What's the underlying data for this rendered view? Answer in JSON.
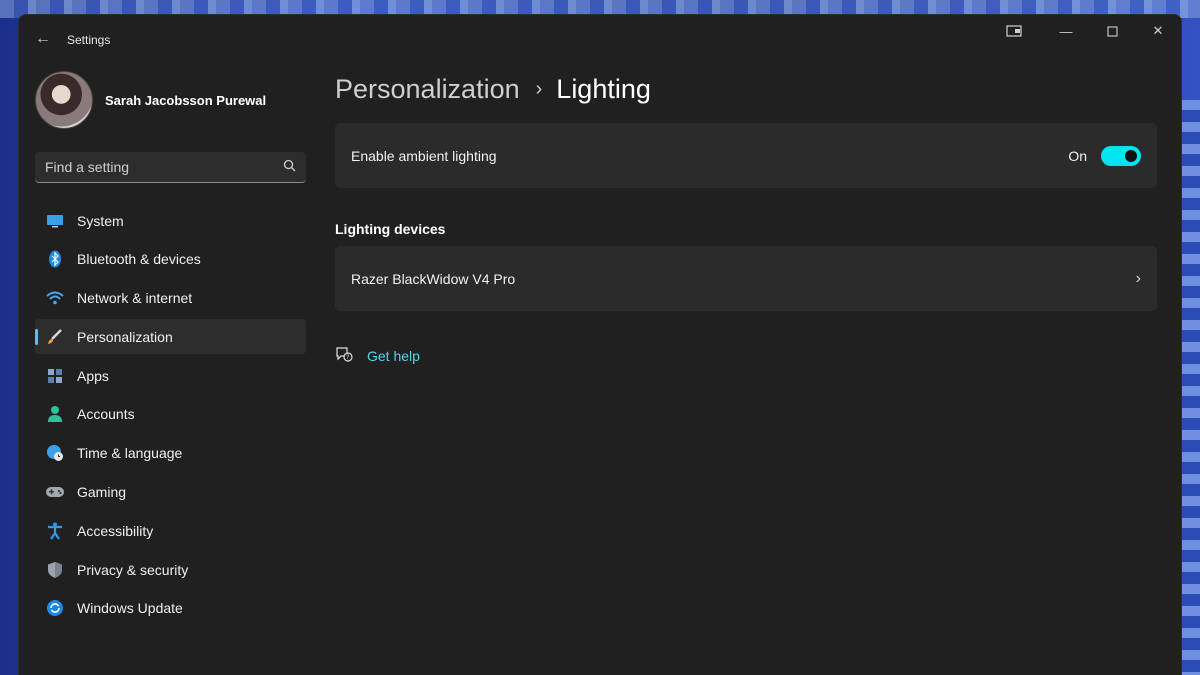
{
  "app": {
    "title": "Settings"
  },
  "user": {
    "name": "Sarah Jacobsson Purewal"
  },
  "search": {
    "placeholder": "Find a setting"
  },
  "sidebar": {
    "items": [
      {
        "label": "System",
        "icon": "monitor-icon"
      },
      {
        "label": "Bluetooth & devices",
        "icon": "bluetooth-icon"
      },
      {
        "label": "Network & internet",
        "icon": "wifi-icon"
      },
      {
        "label": "Personalization",
        "icon": "brush-icon",
        "active": true
      },
      {
        "label": "Apps",
        "icon": "apps-icon"
      },
      {
        "label": "Accounts",
        "icon": "person-icon"
      },
      {
        "label": "Time & language",
        "icon": "globe-clock-icon"
      },
      {
        "label": "Gaming",
        "icon": "gamepad-icon"
      },
      {
        "label": "Accessibility",
        "icon": "accessibility-icon"
      },
      {
        "label": "Privacy & security",
        "icon": "shield-icon"
      },
      {
        "label": "Windows Update",
        "icon": "update-icon"
      }
    ]
  },
  "breadcrumb": {
    "parent": "Personalization",
    "current": "Lighting"
  },
  "ambient": {
    "label": "Enable ambient lighting",
    "state": "On"
  },
  "devices": {
    "heading": "Lighting devices",
    "items": [
      {
        "name": "Razer BlackWidow V4 Pro"
      }
    ]
  },
  "help": {
    "label": "Get help"
  },
  "colors": {
    "accent": "#4cc2ff",
    "toggle": "#00e5f0",
    "link": "#4fd8ef",
    "window_bg": "#202020",
    "card_bg": "#2b2b2b"
  }
}
